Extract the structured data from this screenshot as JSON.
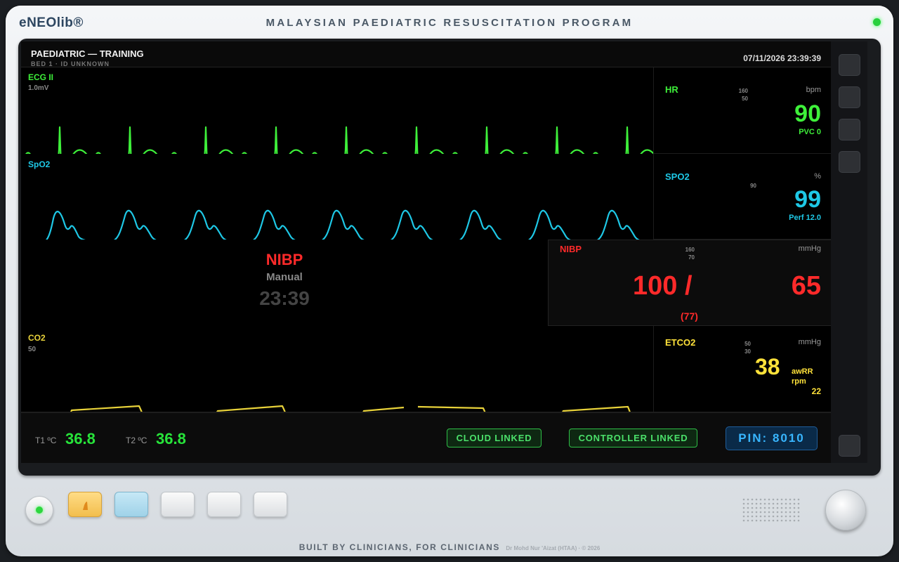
{
  "device": {
    "brand": "eNEOlib®",
    "program_title": "MALAYSIAN PAEDIATRIC RESUSCITATION PROGRAM",
    "tagline": "BUILT BY CLINICIANS, FOR CLINICIANS",
    "credit": "Dr Mohd Nur 'Aizat (HTAA) · © 2026"
  },
  "header": {
    "title": "PAEDIATRIC — TRAINING",
    "subtitle": "BED 1 · ID UNKNOWN",
    "datetime": "07/11/2026 23:39:39"
  },
  "waves": {
    "ecg": {
      "label": "ECG II",
      "scale": "1.0mV",
      "color": "#3ef03a"
    },
    "spo2": {
      "label": "SpO2",
      "color": "#1ec8e6"
    },
    "co2": {
      "label": "CO2",
      "scale": "50",
      "color": "#e8d23a"
    }
  },
  "params": {
    "hr": {
      "name": "HR",
      "lim_hi": "160",
      "lim_lo": "50",
      "unit": "bpm",
      "value": "90",
      "sub": "PVC 0",
      "color": "#3ef03a"
    },
    "spo2": {
      "name": "SPO2",
      "lim_lo": "90",
      "unit": "%",
      "value": "99",
      "sub": "Perf 12.0",
      "color": "#1ec8e6"
    },
    "nibp": {
      "name": "NIBP",
      "lim_hi": "160",
      "lim_lo": "70",
      "unit": "mmHg",
      "systolic": "100 /",
      "diastolic": "65",
      "mean": "(77)",
      "color": "#ff2a2a"
    },
    "etco2": {
      "name": "ETCO2",
      "lim_hi": "50",
      "lim_lo": "30",
      "unit": "mmHg",
      "value": "38",
      "awrr_label": "awRR",
      "awrr_unit": "rpm",
      "awrr_value": "22",
      "color": "#ffe23a"
    }
  },
  "nibp_trigger": {
    "title": "NIBP",
    "mode": "Manual",
    "time": "23:39"
  },
  "footer": {
    "t1_label": "T1 ºC",
    "t1_value": "36.8",
    "t2_label": "T2 ºC",
    "t2_value": "36.8",
    "cloud": "CLOUD LINKED",
    "controller": "CONTROLLER LINKED",
    "pin": "PIN: 8010"
  }
}
